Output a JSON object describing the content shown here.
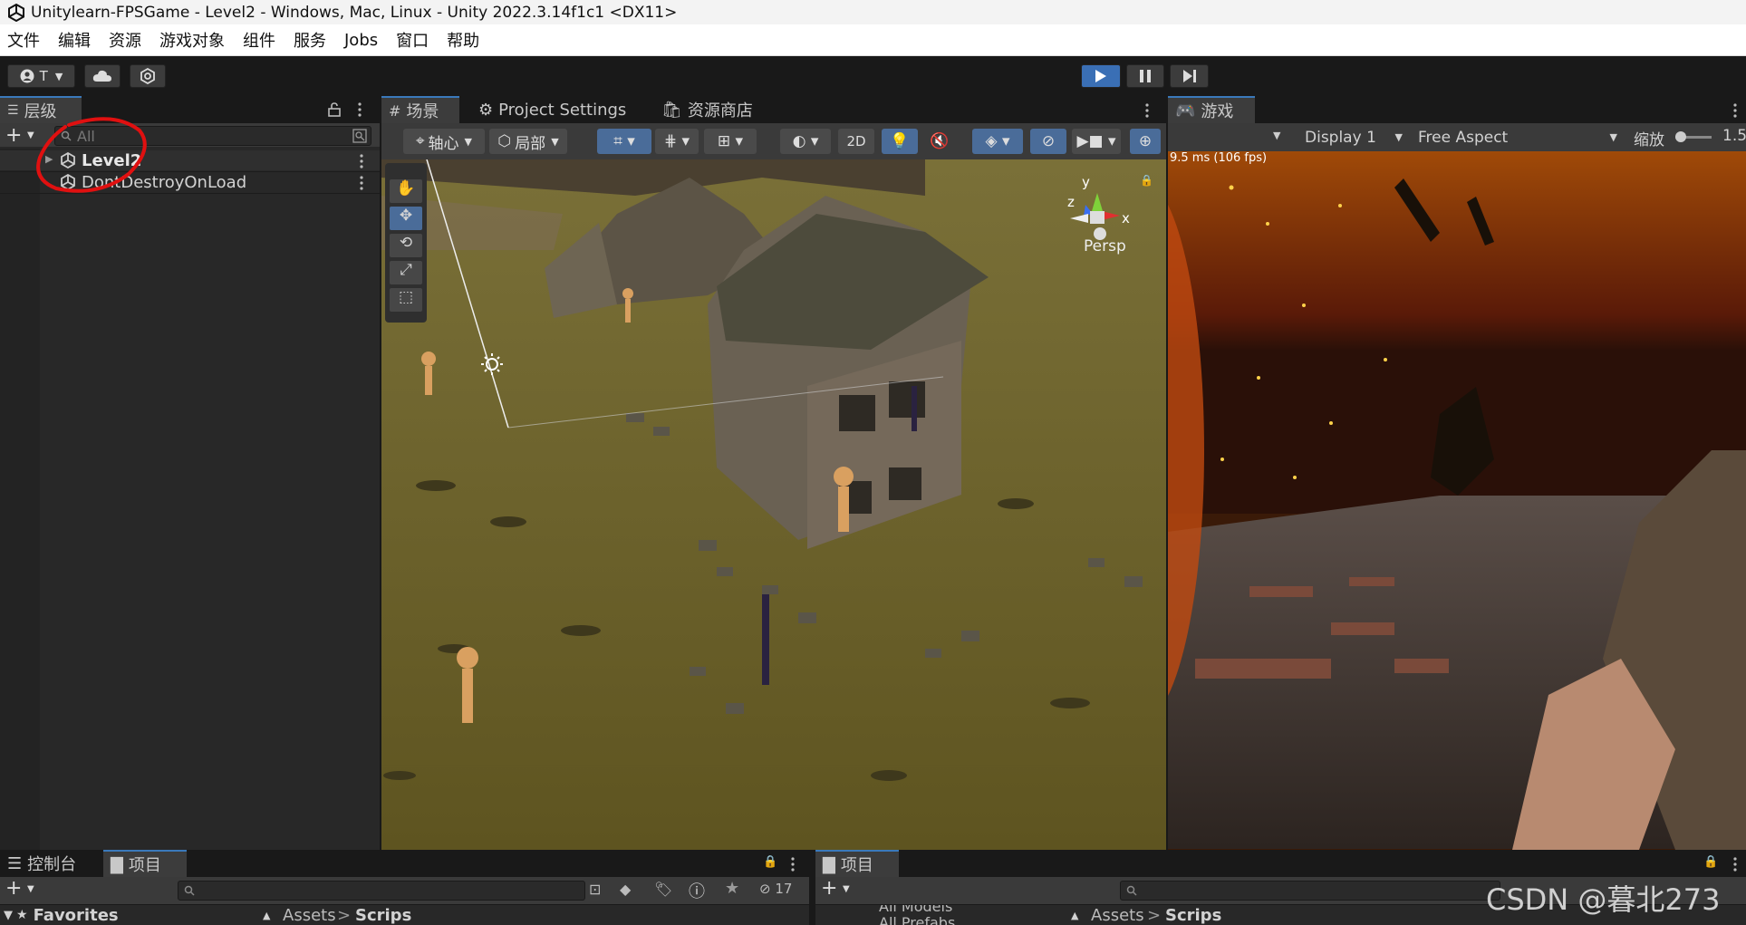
{
  "window": {
    "title": "Unitylearn-FPSGame - Level2 - Windows, Mac, Linux - Unity 2022.3.14f1c1 <DX11>"
  },
  "menu": [
    "文件",
    "编辑",
    "资源",
    "游戏对象",
    "组件",
    "服务",
    "Jobs",
    "窗口",
    "帮助"
  ],
  "toolbar": {
    "account_label": "T"
  },
  "hierarchy": {
    "tab_label": "层级",
    "search_placeholder": "All",
    "items": [
      {
        "label": "Level2"
      },
      {
        "label": "DontDestroyOnLoad"
      }
    ]
  },
  "scene": {
    "tabs": [
      "场景",
      "Project Settings",
      "资源商店"
    ],
    "pivot_label": "轴心",
    "local_label": "局部",
    "mode_2d": "2D",
    "gizmo": {
      "y": "y",
      "z": "z",
      "x": "x",
      "persp": "Persp"
    }
  },
  "game": {
    "tab_label": "游戏",
    "display": "Display 1",
    "aspect": "Free Aspect",
    "scale_label": "缩放",
    "scale_value": "1.5",
    "fps": "9.5 ms (106 fps)"
  },
  "console_panel": {
    "tabs": [
      "控制台",
      "项目"
    ],
    "hidden_count": "17",
    "favorites": "Favorites",
    "breadcrumb": [
      "Assets",
      "Scrips"
    ]
  },
  "project_panel": {
    "tab_label": "项目",
    "favorites_items": [
      "All Models",
      "All Prefabs"
    ],
    "breadcrumb": [
      "Assets",
      "Scrips"
    ]
  },
  "watermark": "CSDN @暮北273",
  "colors": {
    "accent": "#3a79bb",
    "play": "#3a6fb5",
    "annotation": "#e01010"
  }
}
